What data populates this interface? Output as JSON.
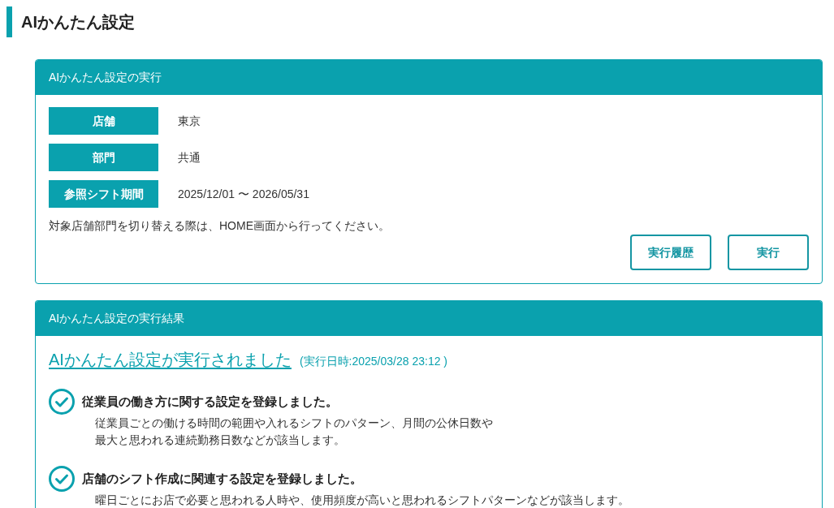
{
  "page_title": "AIかんたん設定",
  "execution_panel": {
    "title": "AIかんたん設定の実行",
    "fields": [
      {
        "label": "店舗",
        "value": "東京"
      },
      {
        "label": "部門",
        "value": "共通"
      },
      {
        "label": "参照シフト期間",
        "value": "2025/12/01 〜 2026/05/31"
      }
    ],
    "note": "対象店舗部門を切り替える際は、HOME画面から行ってください。",
    "buttons": [
      "実行履歴",
      "実行"
    ]
  },
  "result_panel": {
    "title": "AIかんたん設定の実行結果",
    "status_link": "AIかんたん設定が実行されました",
    "executed_at": "(実行日時:2025/03/28 23:12 )",
    "items": [
      {
        "heading": "従業員の働き方に関する設定を登録しました。",
        "description_lines": [
          "従業員ごとの働ける時間の範囲や入れるシフトのパターン、月間の公休日数や",
          "最大と思われる連続勤務日数などが該当します。"
        ]
      },
      {
        "heading": "店舗のシフト作成に関連する設定を登録しました。",
        "description_lines": [
          "曜日ごとにお店で必要と思われる人時や、使用頻度が高いと思われるシフトパターンなどが該当します。"
        ]
      }
    ]
  }
}
